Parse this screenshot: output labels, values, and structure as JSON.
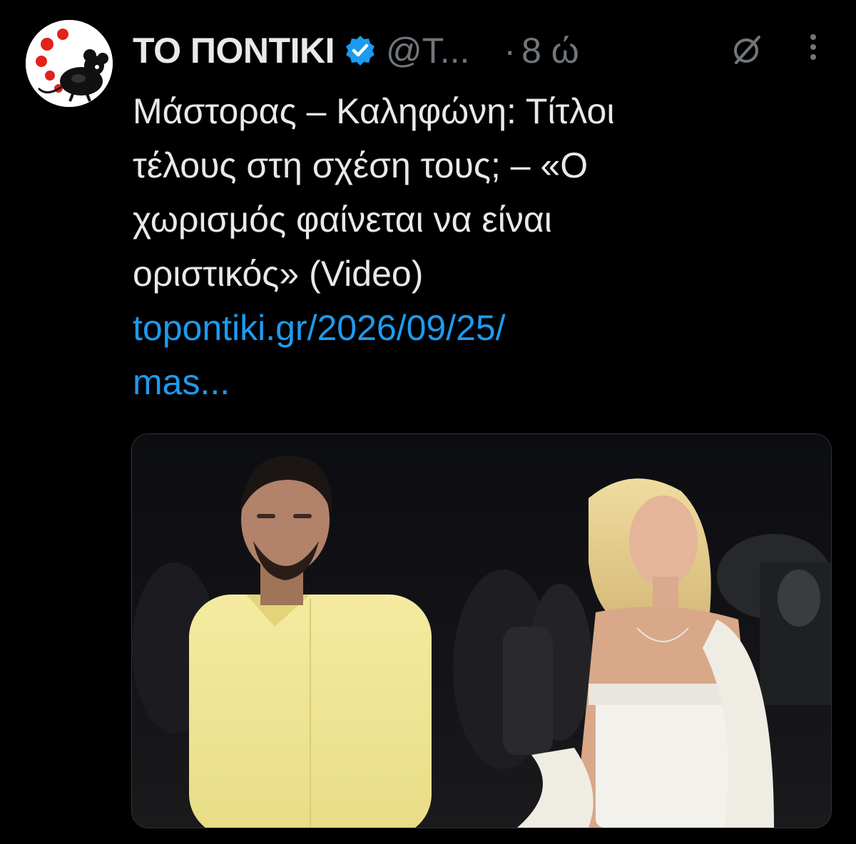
{
  "tweet": {
    "display_name": "ΤΟ ΠΟΝΤΙΚΙ",
    "handle": "@T...",
    "separator": "·",
    "time": "8 ώ",
    "body_lines": [
      "Μάστορας – Καληφώνη: Τίτλοι",
      "τέλους στη σχέση τους; – «Ο",
      "χωρισμός φαίνεται να είναι",
      "οριστικός» (Video)"
    ],
    "link_lines": [
      "topontiki.gr/2026/09/25/",
      "mas..."
    ]
  },
  "icons": {
    "avatar": "pontiki-mouse-logo",
    "verified": "verified-badge-icon",
    "grok": "grok-icon",
    "more": "more-vertical-icon"
  },
  "colors": {
    "background": "#000000",
    "primary_text": "#e7e9ea",
    "secondary_text": "#71767b",
    "link": "#1d9bf0",
    "verified": "#1d9bf0",
    "logo_red": "#e2231a"
  }
}
